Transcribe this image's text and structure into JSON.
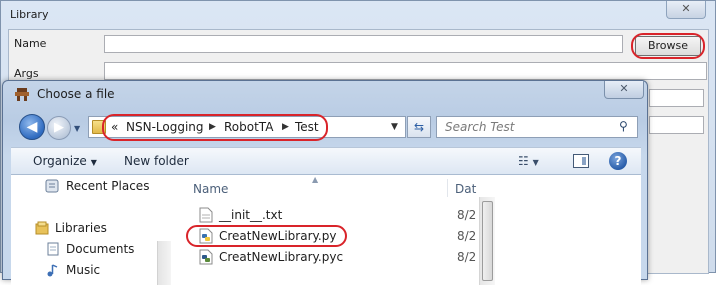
{
  "library": {
    "title": "Library",
    "fields": {
      "name_label": "Name",
      "args_label": "Args"
    },
    "browse_label": "Browse",
    "close_glyph": "✕"
  },
  "file_dialog": {
    "title": "Choose a file",
    "close_glyph": "✕",
    "address": {
      "overflow": "«",
      "crumbs": [
        "NSN-Logging",
        "RobotTA",
        "Test"
      ]
    },
    "search_placeholder": "Search Test",
    "toolbar": {
      "organize_label": "Organize",
      "new_folder_label": "New folder"
    },
    "nav_pane": {
      "recent_places": "Recent Places",
      "libraries": "Libraries",
      "documents": "Documents",
      "music": "Music"
    },
    "columns": {
      "name": "Name",
      "date": "Dat"
    },
    "files": [
      {
        "name": "__init__.txt",
        "date": "8/2",
        "type": "txt"
      },
      {
        "name": "CreatNewLibrary.py",
        "date": "8/2",
        "type": "py"
      },
      {
        "name": "CreatNewLibrary.pyc",
        "date": "8/2",
        "type": "pyc"
      }
    ]
  },
  "colors": {
    "annotation_red": "#d9242a",
    "title_bar": "#c4d4e8"
  }
}
